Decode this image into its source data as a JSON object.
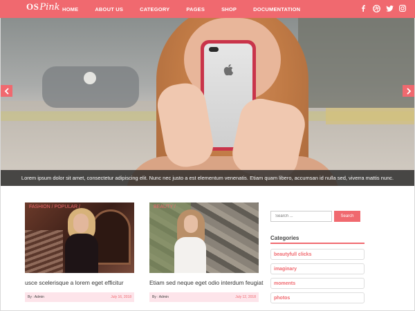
{
  "brand": {
    "logo_os": "OS",
    "logo_pink": "Pink"
  },
  "nav": [
    "HOME",
    "ABOUT US",
    "CATEGORY",
    "PAGES",
    "SHOP",
    "DOCUMENTATION"
  ],
  "social": [
    "facebook-icon",
    "dribbble-icon",
    "twitter-icon",
    "instagram-icon"
  ],
  "hero": {
    "caption": "Lorem ipsum dolor sit amet, consectetur adipiscing elit. Nunc nec justo a est elementum venenatis. Etiam quam libero, accumsan id nulla sed, viverra mattis nunc."
  },
  "posts": [
    {
      "category": "FASHION / POPULAR /",
      "title": "usce scelerisque a lorem eget efficitur",
      "author": "By : Admin",
      "date": "July 16, 2018"
    },
    {
      "category": "BEAUTY /",
      "title": "Etiam sed neque eget odio interdum feugiat",
      "author": "By : Admin",
      "date": "July 12, 2018"
    }
  ],
  "sidebar": {
    "search_placeholder": "Search ...",
    "search_button": "Search",
    "categories_title": "Categories",
    "categories": [
      "beautyfull clicks",
      "imaginary",
      "moments",
      "photos"
    ]
  },
  "colors": {
    "accent": "#f0696f",
    "meta_bg": "#fde4ea"
  }
}
